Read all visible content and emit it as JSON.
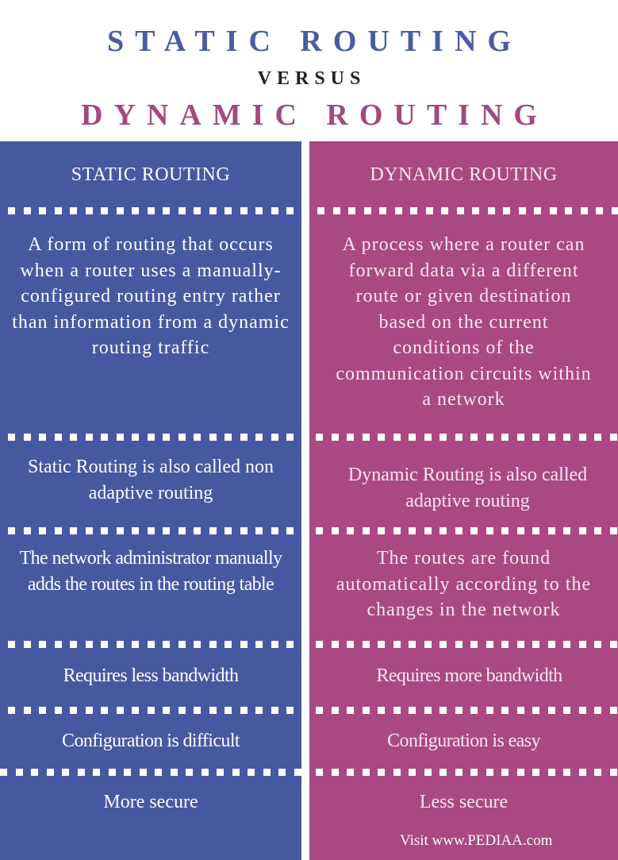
{
  "title": {
    "line1": "STATIC ROUTING",
    "line2": "VERSUS",
    "line3": "DYNAMIC ROUTING"
  },
  "colors": {
    "static_blue": "#4659a0",
    "dynamic_magenta": "#aa4883",
    "title_blue": "#4a5ba0",
    "title_magenta": "#a4487f",
    "versus_dark": "#222222"
  },
  "left": {
    "header": "STATIC ROUTING",
    "rows": [
      "A form of routing that occurs when a router uses a manually-configured routing entry rather than information from a dynamic routing traffic",
      "Static Routing is also called non adaptive routing",
      "The network administrator manually adds the routes in the routing table",
      "Requires less bandwidth",
      "Configuration is difficult",
      "More secure"
    ]
  },
  "right": {
    "header": "DYNAMIC ROUTING",
    "rows": [
      "A process where a router can forward data via a different route or given destination based on the current conditions of the communication circuits within a network",
      "Dynamic Routing is also called adaptive routing",
      "The routes are found automatically according to the changes in the network",
      "Requires more bandwidth",
      "Configuration is easy",
      "Less secure"
    ]
  },
  "footer": {
    "credit": "Visit www.PEDIAA.com"
  }
}
